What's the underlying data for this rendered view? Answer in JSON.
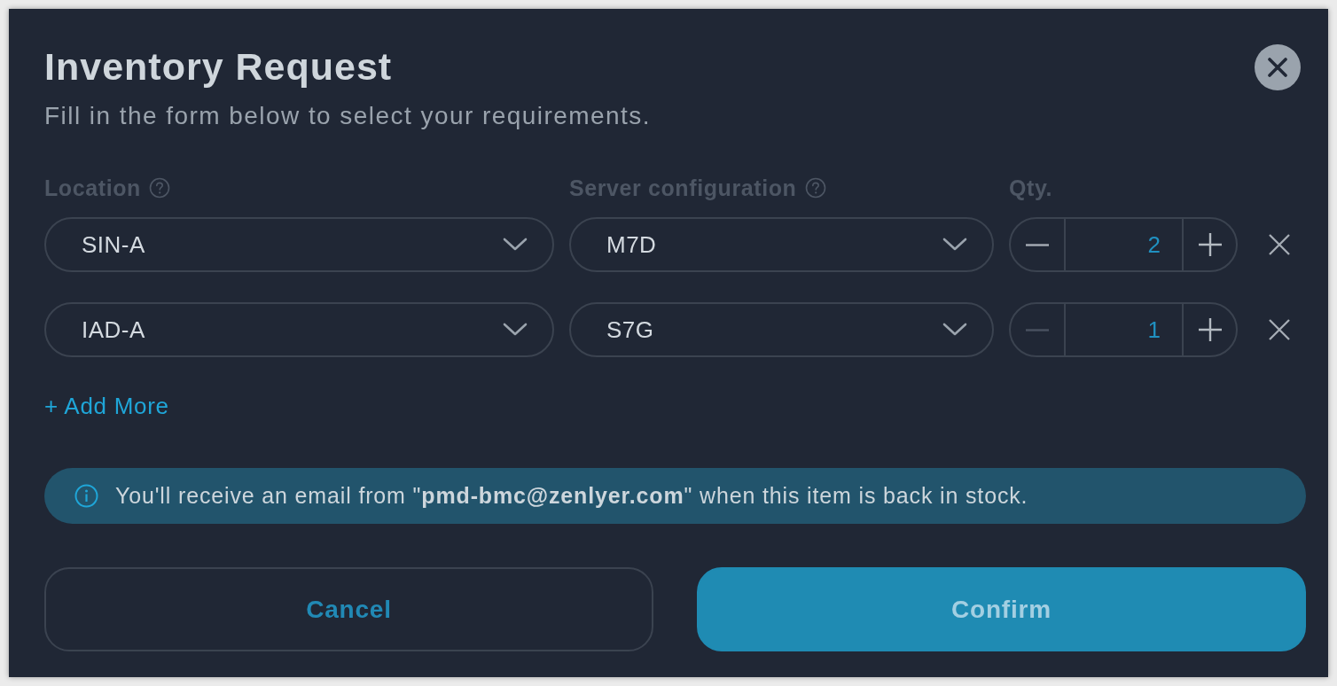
{
  "dialog": {
    "title": "Inventory Request",
    "subtitle": "Fill in the form below to select your requirements."
  },
  "columns": [
    {
      "label": "Location",
      "help": true
    },
    {
      "label": "Server configuration",
      "help": true
    },
    {
      "label": "Qty.",
      "help": false
    }
  ],
  "rows": [
    {
      "location": "SIN-A",
      "configuration": "M7D",
      "quantity": "2",
      "decrease_disabled": false
    },
    {
      "location": "IAD-A",
      "configuration": "S7G",
      "quantity": "1",
      "decrease_disabled": true
    }
  ],
  "add_more": "+ Add More",
  "notice": "You'll receive an email from \"**pmd-bmc@zenlyer.com**\" when this item is back in stock.",
  "buttons": [
    {
      "label": "Cancel",
      "kind": "secondary"
    },
    {
      "label": "Confirm",
      "kind": "primary"
    }
  ]
}
